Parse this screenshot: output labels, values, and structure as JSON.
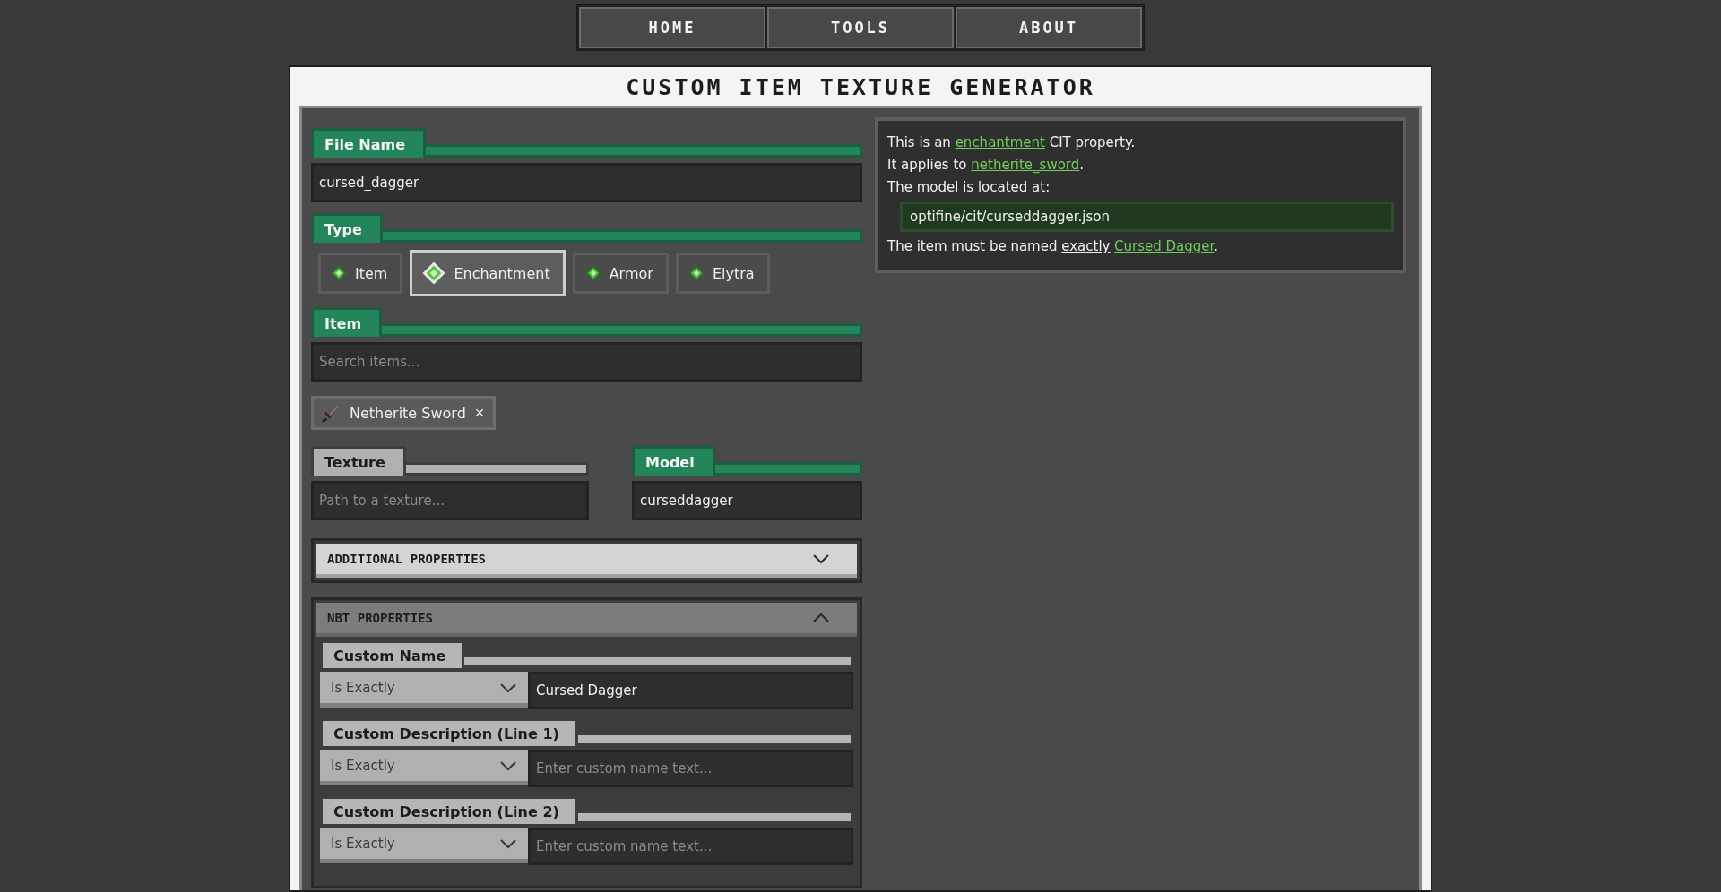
{
  "nav": [
    {
      "label": "HOME"
    },
    {
      "label": "TOOLS"
    },
    {
      "label": "ABOUT"
    }
  ],
  "title": "CUSTOM ITEM TEXTURE GENERATOR",
  "file_name": {
    "label": "File Name",
    "valid": true,
    "value": "cursed_dagger"
  },
  "type": {
    "label": "Type",
    "valid": true,
    "options": [
      {
        "label": "Item",
        "selected": false
      },
      {
        "label": "Enchantment",
        "selected": true
      },
      {
        "label": "Armor",
        "selected": false
      },
      {
        "label": "Elytra",
        "selected": false
      }
    ]
  },
  "item": {
    "label": "Item",
    "valid": true,
    "placeholder": "Search items...",
    "chips": [
      {
        "label": "Netherite Sword",
        "remove": "×"
      }
    ]
  },
  "texture": {
    "label": "Texture",
    "valid": false,
    "placeholder": "Path to a texture..."
  },
  "model": {
    "label": "Model",
    "valid": true,
    "value": "curseddagger"
  },
  "sections": [
    {
      "title": "ADDITIONAL PROPERTIES",
      "expanded": false
    },
    {
      "title": "NBT PROPERTIES",
      "expanded": true
    }
  ],
  "nbt": [
    {
      "label": "Custom Name",
      "match": "Is Exactly",
      "value": "Cursed Dagger"
    },
    {
      "label": "Custom Description (Line 1)",
      "match": "Is Exactly",
      "placeholder": "Enter custom name text..."
    },
    {
      "label": "Custom Description (Line 2)",
      "match": "Is Exactly",
      "placeholder": "Enter custom name text..."
    }
  ],
  "info": {
    "lines": [
      [
        {
          "kind": "plain",
          "text": "This is an "
        },
        {
          "kind": "link",
          "text": "enchantment"
        },
        {
          "kind": "plain",
          "text": " CIT property."
        }
      ],
      [
        {
          "kind": "plain",
          "text": "It applies to "
        },
        {
          "kind": "link",
          "text": "netherite_sword"
        },
        {
          "kind": "plain",
          "text": "."
        }
      ],
      [
        {
          "kind": "plain",
          "text": "The model is located at:"
        }
      ],
      [
        {
          "kind": "code",
          "text": "optifine/cit/curseddagger.json"
        }
      ],
      [
        {
          "kind": "plain",
          "text": "The item must be named "
        },
        {
          "kind": "emphasis",
          "text": "exactly"
        },
        {
          "kind": "link",
          "text": "Cursed Dagger"
        },
        {
          "kind": "plain",
          "text": "."
        }
      ]
    ]
  }
}
